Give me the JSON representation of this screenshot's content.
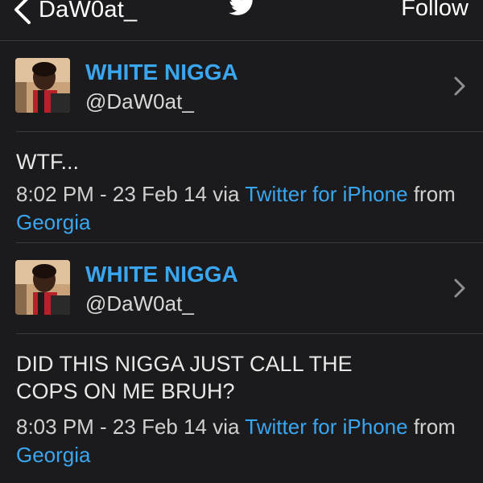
{
  "navbar": {
    "back_label": "DaW0at_",
    "center_icon": "twitter-bird-icon",
    "follow_label": "Follow"
  },
  "tweets": [
    {
      "display_name": "WHITE NIGGA",
      "handle": "@DaW0at_",
      "text": "WTF...",
      "time": "8:02 PM - 23 Feb 14",
      "via": "via",
      "client": "Twitter for iPhone",
      "from": "from",
      "location": "Georgia"
    },
    {
      "display_name": "WHITE NIGGA",
      "handle": "@DaW0at_",
      "text": "DID THIS NIGGA JUST CALL THE\nCOPS ON ME BRUH?",
      "time": "8:03 PM - 23 Feb 14",
      "via": "via",
      "client": "Twitter for iPhone",
      "from": "from",
      "location": "Georgia"
    }
  ],
  "colors": {
    "background": "#1b1b1d",
    "link": "#3aa6f0",
    "text": "#e8e8e8",
    "divider": "#3a3a3c"
  }
}
